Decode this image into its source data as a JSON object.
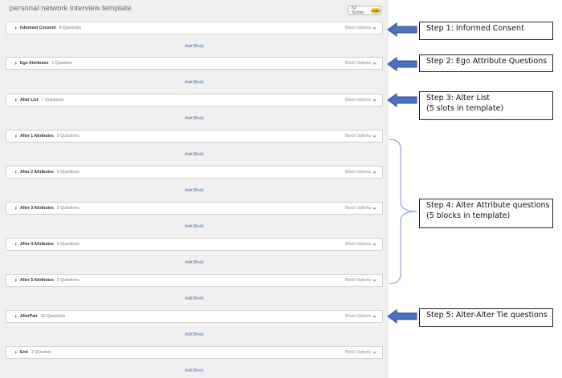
{
  "survey": {
    "title": "personal network interview template",
    "iq_score_label": "iQ Score:",
    "iq_score_value": "Fair"
  },
  "blocks": [
    {
      "name": "Informed Consent",
      "count": "4 Questions",
      "options": "Block Options",
      "add": "Add Block"
    },
    {
      "name": "Ego Attributes",
      "count": "1 Question",
      "options": "Block Options",
      "add": "Add Block"
    },
    {
      "name": "Alter List",
      "count": "7 Questions",
      "options": "Block Options",
      "add": "Add Block"
    },
    {
      "name": "Alter 1 Attributes",
      "count": "5 Questions",
      "options": "Block Options",
      "add": "Add Block"
    },
    {
      "name": "Alter 2 Attributes",
      "count": "5 Questions",
      "options": "Block Options",
      "add": "Add Block"
    },
    {
      "name": "Alter 3 Attributes",
      "count": "5 Questions",
      "options": "Block Options",
      "add": "Add Block"
    },
    {
      "name": "Alter 4 Attributes",
      "count": "5 Questions",
      "options": "Block Options",
      "add": "Add Block"
    },
    {
      "name": "Alter 5 Attributes",
      "count": "5 Questions",
      "options": "Block Options",
      "add": "Add Block"
    },
    {
      "name": "AlterPair",
      "count": "10 Questions",
      "options": "Block Options",
      "add": "Add Block"
    },
    {
      "name": "End",
      "count": "1 Question",
      "options": "Block Options",
      "add": "Add Block"
    }
  ],
  "annotations": {
    "step1": [
      "Step 1: Informed Consent"
    ],
    "step2": [
      "Step 2: Ego Attribute Questions"
    ],
    "step3": [
      "Step 3: Alter List",
      "(5 slots in template)"
    ],
    "step4": [
      "Step 4: Alter Attribute questions",
      "(5 blocks in template)"
    ],
    "step5": [
      "Step 5: Alter-Alter Tie questions"
    ]
  },
  "colors": {
    "arrow_fill": "#4a72c4",
    "arrow_stroke": "#2f4f8f",
    "bracket": "#8fa3d6",
    "link": "#3a6fb0"
  }
}
